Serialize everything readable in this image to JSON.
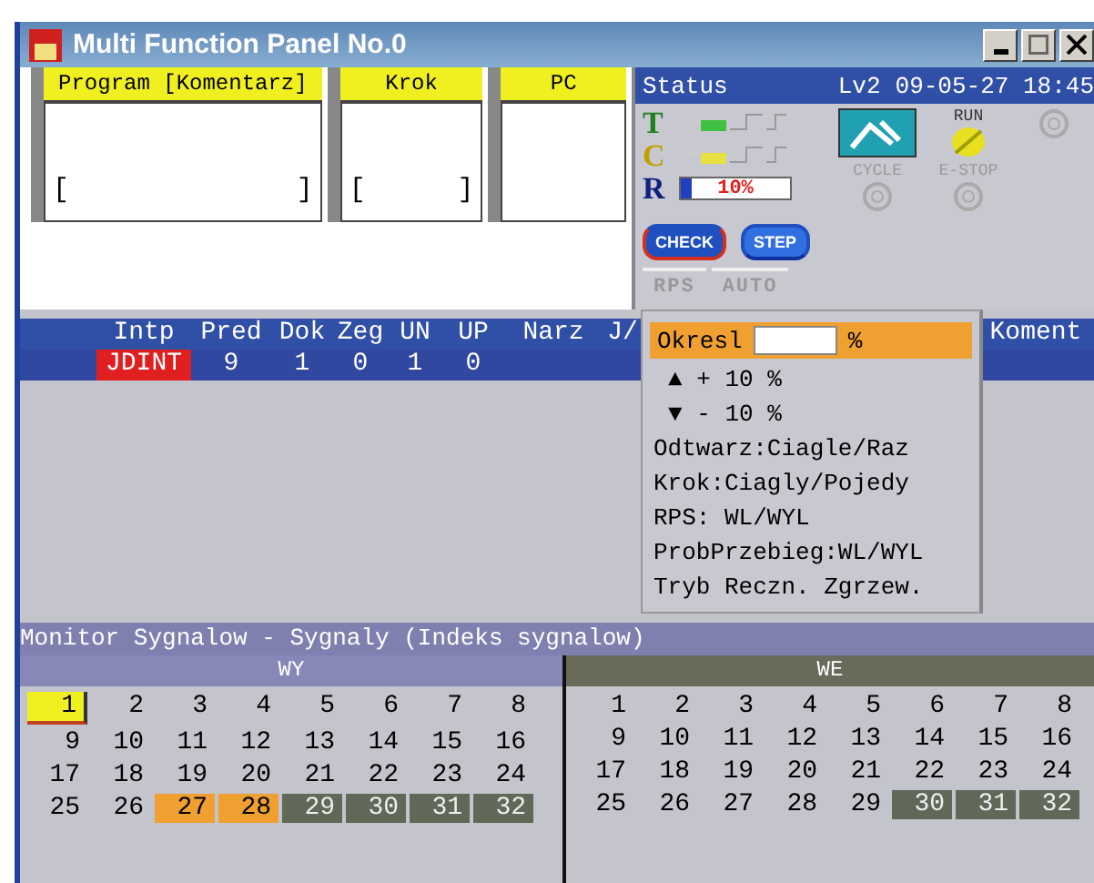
{
  "window": {
    "title": "Multi Function Panel No.0"
  },
  "panels": [
    {
      "title": "Program [Komentarz]",
      "open": "[",
      "close": "]"
    },
    {
      "title": "Krok",
      "open": "[",
      "close": "]"
    },
    {
      "title": "PC"
    }
  ],
  "status": {
    "title": "Status",
    "level_label": "Lv2",
    "datetime": "09-05-27 18:45",
    "rows": [
      {
        "label": "T",
        "kind": "switch"
      },
      {
        "label": "C",
        "kind": "switch"
      },
      {
        "label": "R",
        "kind": "meter",
        "level": 0.1,
        "reading": "10%"
      }
    ],
    "lamps": [
      {
        "kind": "mode"
      },
      {
        "kind": "lamp",
        "label": "RUN",
        "on": true
      },
      {
        "kind": "lamp",
        "on": false
      },
      {
        "kind": "lamp",
        "label": "CYCLE",
        "on": false
      },
      {
        "kind": "lamp",
        "label": "E-STOP",
        "on": false
      }
    ],
    "buttons": [
      "CHECK",
      "STEP"
    ],
    "tabs": [
      "RPS",
      "AUTO"
    ]
  },
  "table": {
    "columns": [
      "Intp",
      "Pred",
      "Dok",
      "Zeg",
      "UN",
      "UP",
      "Narz",
      "J/",
      "Koment"
    ],
    "rows": [
      {
        "selected": true,
        "cells": [
          {
            "text": "JDINT",
            "highlighted": true
          },
          {
            "text": "9",
            "highlighted": false
          },
          {
            "text": "1",
            "highlighted": false
          },
          {
            "text": "0",
            "highlighted": false
          },
          {
            "text": "1",
            "highlighted": false
          },
          {
            "text": "0",
            "highlighted": false
          }
        ]
      }
    ]
  },
  "popup": {
    "field_label": "Okresl",
    "unit": "%",
    "items": [
      "▲ + 10 %",
      "▼ - 10 %",
      "Odtwarz:Ciagle/Raz",
      "Krok:Ciagly/Pojedy",
      "RPS: WL/WYL",
      "ProbPrzebieg:WL/WYL",
      "Tryb Reczn. Zgrzew."
    ]
  },
  "monitor": {
    "title": "Monitor Sygnalow - Sygnaly (Indeks sygnalow)",
    "groups": [
      {
        "title": "WY",
        "signals": [
          {
            "label": "1",
            "kind": "cursor"
          },
          {
            "label": "2",
            "kind": "plain"
          },
          {
            "label": "3",
            "kind": "plain"
          },
          {
            "label": "4",
            "kind": "plain"
          },
          {
            "label": "5",
            "kind": "plain"
          },
          {
            "label": "6",
            "kind": "plain"
          },
          {
            "label": "7",
            "kind": "plain"
          },
          {
            "label": "8",
            "kind": "plain"
          },
          {
            "label": "9",
            "kind": "plain"
          },
          {
            "label": "10",
            "kind": "plain"
          },
          {
            "label": "11",
            "kind": "plain"
          },
          {
            "label": "12",
            "kind": "plain"
          },
          {
            "label": "13",
            "kind": "plain"
          },
          {
            "label": "14",
            "kind": "plain"
          },
          {
            "label": "15",
            "kind": "plain"
          },
          {
            "label": "16",
            "kind": "plain"
          },
          {
            "label": "17",
            "kind": "plain"
          },
          {
            "label": "18",
            "kind": "plain"
          },
          {
            "label": "19",
            "kind": "plain"
          },
          {
            "label": "20",
            "kind": "plain"
          },
          {
            "label": "21",
            "kind": "plain"
          },
          {
            "label": "22",
            "kind": "plain"
          },
          {
            "label": "23",
            "kind": "plain"
          },
          {
            "label": "24",
            "kind": "plain"
          },
          {
            "label": "25",
            "kind": "plain"
          },
          {
            "label": "26",
            "kind": "plain"
          },
          {
            "label": "27",
            "kind": "active"
          },
          {
            "label": "28",
            "kind": "active"
          },
          {
            "label": "29",
            "kind": "dark"
          },
          {
            "label": "30",
            "kind": "dark"
          },
          {
            "label": "31",
            "kind": "dark"
          },
          {
            "label": "32",
            "kind": "dark"
          }
        ]
      },
      {
        "title": "WE",
        "signals": [
          {
            "label": "1",
            "kind": "plain"
          },
          {
            "label": "2",
            "kind": "plain"
          },
          {
            "label": "3",
            "kind": "plain"
          },
          {
            "label": "4",
            "kind": "plain"
          },
          {
            "label": "5",
            "kind": "plain"
          },
          {
            "label": "6",
            "kind": "plain"
          },
          {
            "label": "7",
            "kind": "plain"
          },
          {
            "label": "8",
            "kind": "plain"
          },
          {
            "label": "9",
            "kind": "plain"
          },
          {
            "label": "10",
            "kind": "plain"
          },
          {
            "label": "11",
            "kind": "plain"
          },
          {
            "label": "12",
            "kind": "plain"
          },
          {
            "label": "13",
            "kind": "plain"
          },
          {
            "label": "14",
            "kind": "plain"
          },
          {
            "label": "15",
            "kind": "plain"
          },
          {
            "label": "16",
            "kind": "plain"
          },
          {
            "label": "17",
            "kind": "plain"
          },
          {
            "label": "18",
            "kind": "plain"
          },
          {
            "label": "19",
            "kind": "plain"
          },
          {
            "label": "20",
            "kind": "plain"
          },
          {
            "label": "21",
            "kind": "plain"
          },
          {
            "label": "22",
            "kind": "plain"
          },
          {
            "label": "23",
            "kind": "plain"
          },
          {
            "label": "24",
            "kind": "plain"
          },
          {
            "label": "25",
            "kind": "plain"
          },
          {
            "label": "26",
            "kind": "plain"
          },
          {
            "label": "27",
            "kind": "plain"
          },
          {
            "label": "28",
            "kind": "plain"
          },
          {
            "label": "29",
            "kind": "plain"
          },
          {
            "label": "30",
            "kind": "dark"
          },
          {
            "label": "31",
            "kind": "dark"
          },
          {
            "label": "32",
            "kind": "dark"
          }
        ]
      }
    ]
  }
}
